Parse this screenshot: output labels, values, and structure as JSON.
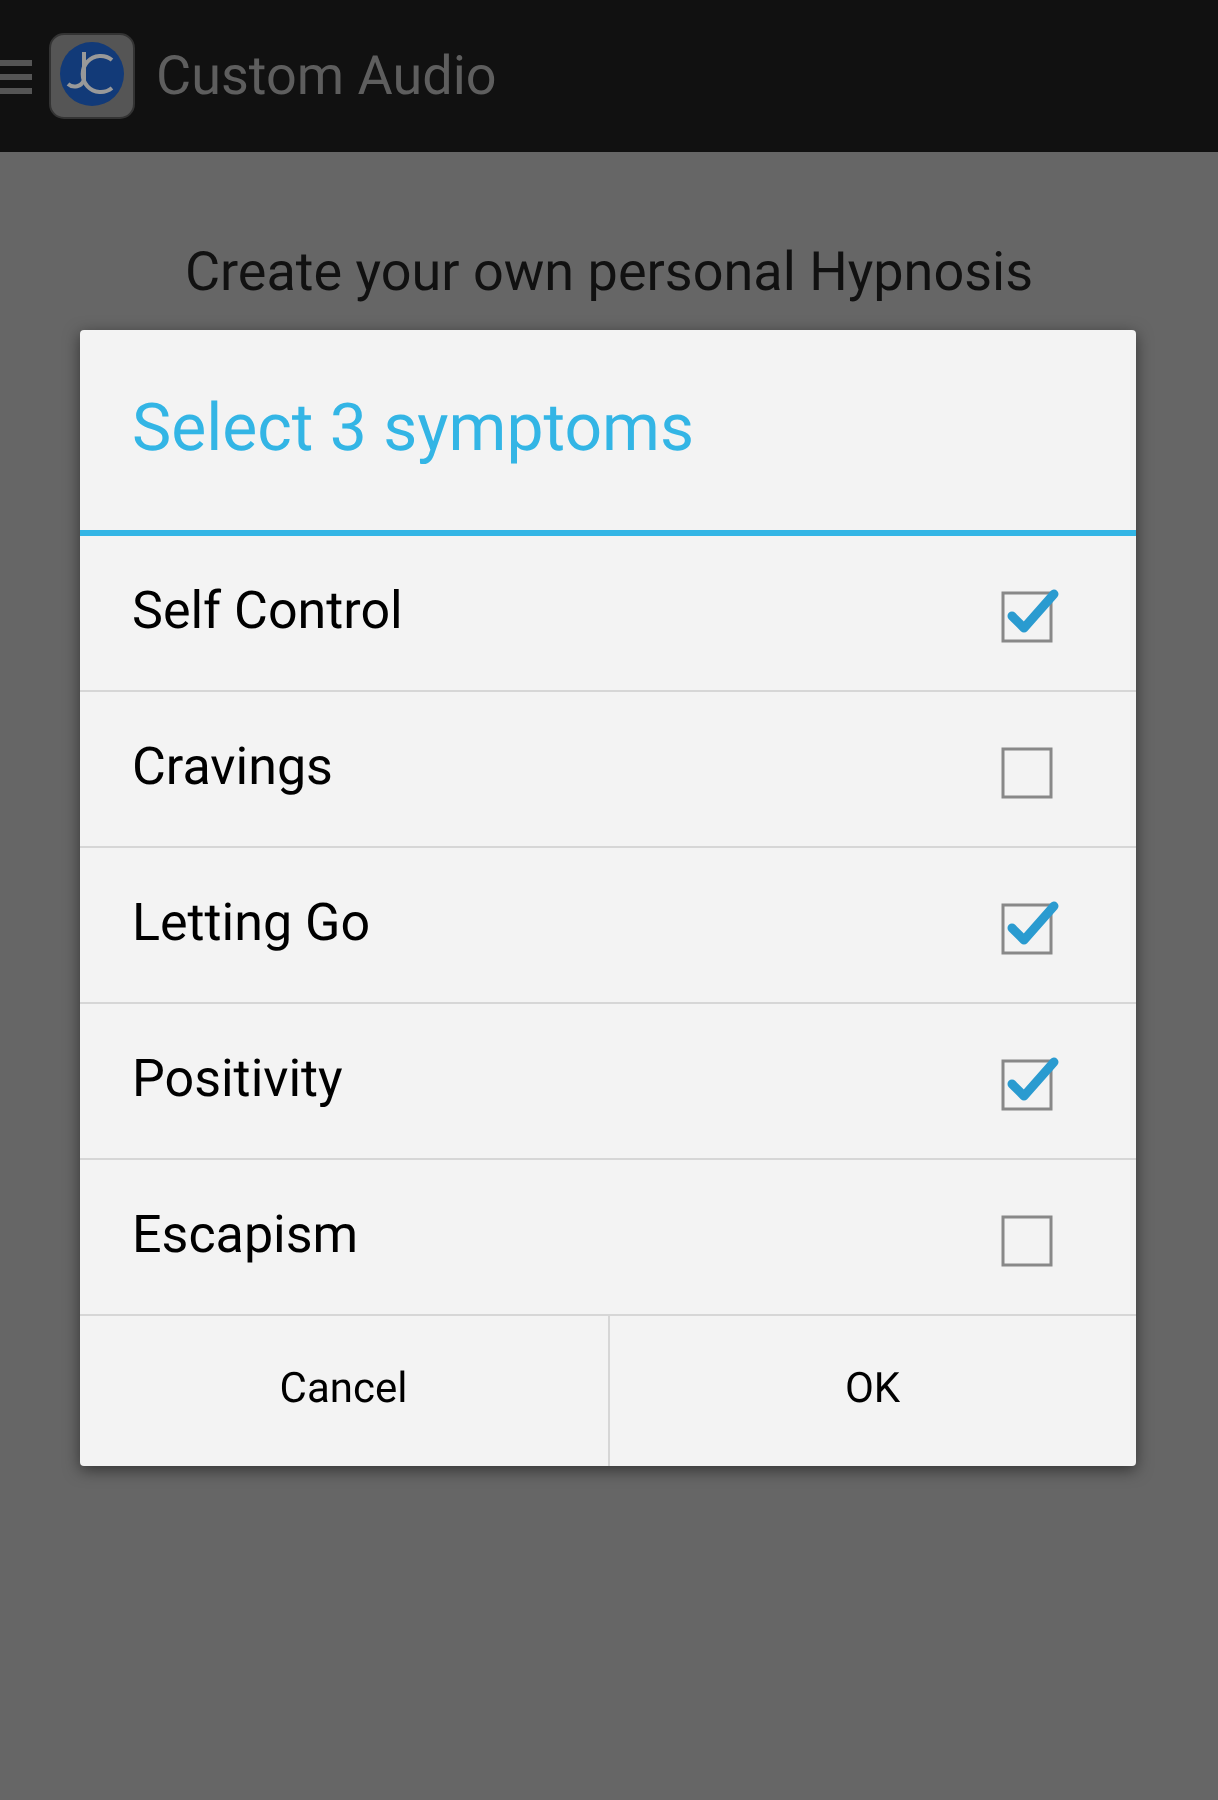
{
  "app_bar": {
    "title": "Custom Audio"
  },
  "intro": {
    "text": "Create your own personal Hypnosis"
  },
  "dialog": {
    "title": "Select 3 symptoms",
    "options": [
      {
        "label": "Self Control",
        "checked": true
      },
      {
        "label": "Cravings",
        "checked": false
      },
      {
        "label": "Letting Go",
        "checked": true
      },
      {
        "label": "Positivity",
        "checked": true
      },
      {
        "label": "Escapism",
        "checked": false
      }
    ],
    "buttons": [
      "Cancel",
      "OK"
    ]
  }
}
